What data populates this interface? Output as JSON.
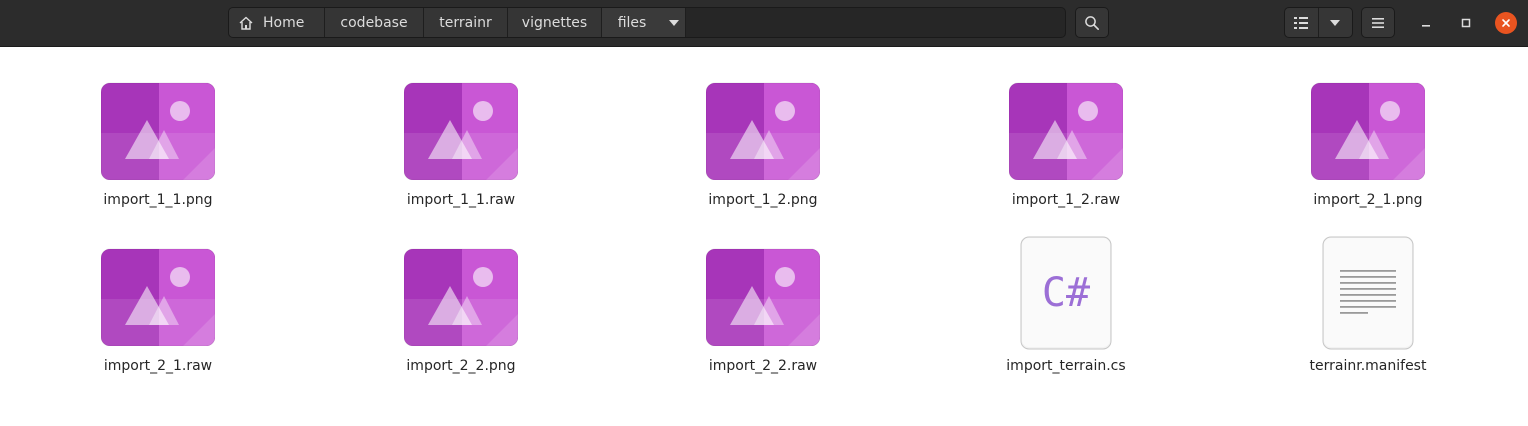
{
  "headerbar": {
    "breadcrumbs": [
      {
        "label": "Home"
      },
      {
        "label": "codebase"
      },
      {
        "label": "terrainr"
      },
      {
        "label": "vignettes"
      },
      {
        "label": "files"
      }
    ],
    "icons": {
      "home": "home-icon",
      "path_menu": "chevron-down-icon",
      "search": "search-icon",
      "view_list": "list-view-icon",
      "view_options": "chevron-down-icon",
      "main_menu": "hamburger-menu-icon",
      "minimize": "minimize-icon",
      "maximize": "maximize-icon",
      "close": "close-icon"
    }
  },
  "files": [
    {
      "name": "import_1_1.png",
      "icon": "image-icon"
    },
    {
      "name": "import_1_1.raw",
      "icon": "image-icon"
    },
    {
      "name": "import_1_2.png",
      "icon": "image-icon"
    },
    {
      "name": "import_1_2.raw",
      "icon": "image-icon"
    },
    {
      "name": "import_2_1.png",
      "icon": "image-icon"
    },
    {
      "name": "import_2_1.raw",
      "icon": "image-icon"
    },
    {
      "name": "import_2_2.png",
      "icon": "image-icon"
    },
    {
      "name": "import_2_2.raw",
      "icon": "image-icon"
    },
    {
      "name": "import_terrain.cs",
      "icon": "csharp-file-icon",
      "glyph": "C#"
    },
    {
      "name": "terrainr.manifest",
      "icon": "text-file-icon"
    }
  ],
  "colors": {
    "headerbar": "#2c2c2c",
    "image_icon_dark": "#a93bbd",
    "image_icon_light": "#cc61d6",
    "csharp_glyph": "#9c6fd6",
    "close_button": "#e95420"
  }
}
